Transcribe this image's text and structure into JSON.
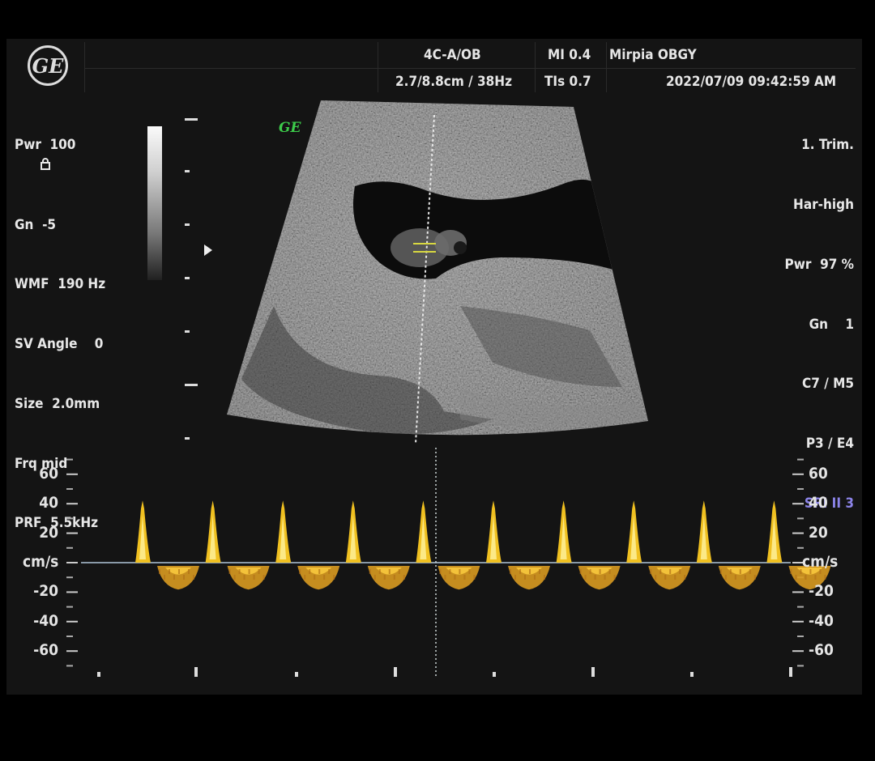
{
  "header": {
    "probe_exam": "4C-A/OB",
    "depth_fr": "2.7/8.8cm / 38Hz",
    "mi": "MI  0.4",
    "tis": "TIs  0.7",
    "user": "Mirpia OBGY",
    "datetime": "2022/07/09  09:42:59 AM",
    "logo": "GE"
  },
  "left_params": {
    "pwr": "Pwr  100",
    "gn": "Gn  -5",
    "wmf": "WMF  190 Hz",
    "sv_angle": "SV Angle    0",
    "size": "Size  2.0mm",
    "frq": "Frq mid",
    "prf": "PRF  5.5kHz"
  },
  "right_params": {
    "trim": "1. Trim.",
    "har": "Har-high",
    "pwr": "Pwr  97 %",
    "gn": "Gn    1",
    "c7": "C7 / M5",
    "p3": "P3 / E4",
    "sri": "SRI II 3"
  },
  "image": {
    "ge_mark": "GE",
    "sample_gate": "PW sample volume"
  },
  "doppler": {
    "unit": "cm/s",
    "scale_left": [
      "60",
      "40",
      "20",
      "-20",
      "-40",
      "-60"
    ],
    "scale_right": [
      "60",
      "40",
      "20",
      "-20",
      "-40",
      "-60"
    ],
    "peak_velocity": 40,
    "trough_velocity": -15,
    "beats": 10,
    "trace_color": "#f0c020",
    "baseline_color": "#8a9aa8"
  },
  "icons": {
    "lock": "lock-icon",
    "focus": "focus-marker-icon"
  }
}
